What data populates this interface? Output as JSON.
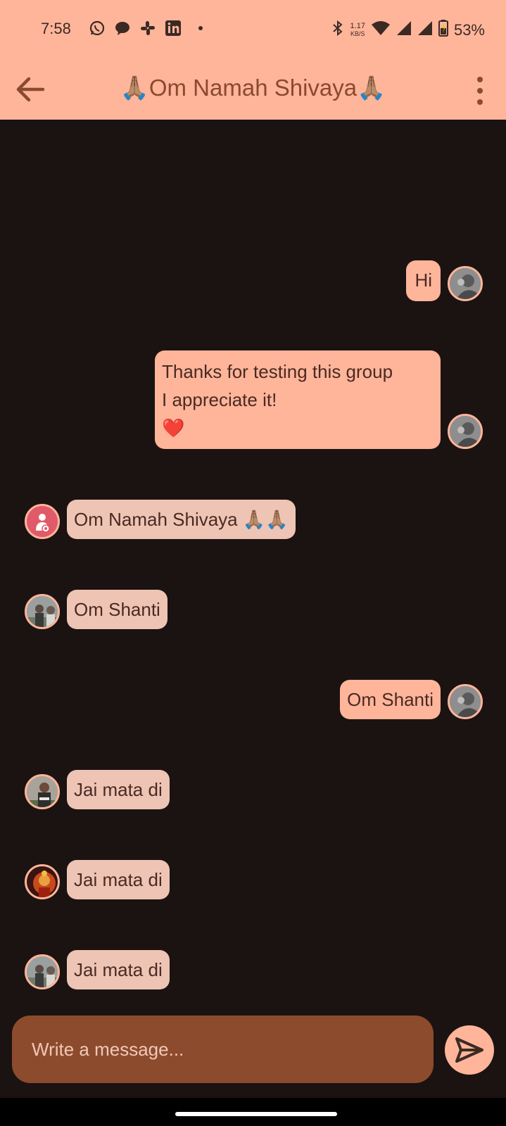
{
  "status": {
    "time": "7:58",
    "speed_value": "1.17",
    "speed_unit": "KB/S",
    "battery": "53%",
    "left_icons": [
      "whatsapp-icon",
      "messages-icon",
      "slack-icon",
      "linkedin-icon"
    ]
  },
  "header": {
    "title": "🙏🏽Om Namah Shivaya🙏🏽",
    "back_icon": "arrow-left-icon",
    "menu_icon": "more-vert-icon"
  },
  "messages": [
    {
      "side": "out",
      "text": "Hi"
    },
    {
      "side": "out",
      "line1": "Thanks for testing this group",
      "line2": "I appreciate it!",
      "emoji": "❤️"
    },
    {
      "side": "in",
      "text": "Om Namah Shivaya 🙏🏽🙏🏽"
    },
    {
      "side": "in",
      "text": "Om Shanti"
    },
    {
      "side": "out",
      "text": "Om Shanti"
    },
    {
      "side": "in",
      "text": "Jai mata di"
    },
    {
      "side": "in",
      "text": "Jai mata di"
    },
    {
      "side": "in",
      "text": "Jai mata di"
    }
  ],
  "composer": {
    "placeholder": "Write a message...",
    "send_icon": "send-icon"
  },
  "colors": {
    "accent": "#ffb59a",
    "background": "#1b1311",
    "incoming_bubble": "#eec4b4",
    "composer": "#8d4b2d"
  }
}
